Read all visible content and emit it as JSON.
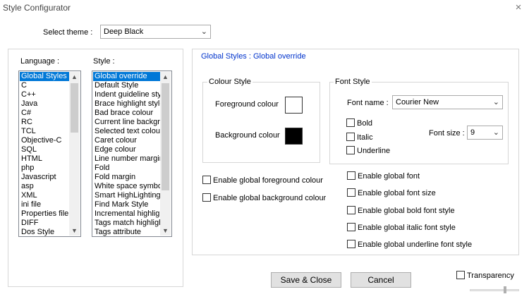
{
  "window": {
    "title": "Style Configurator",
    "close_glyph": "×"
  },
  "theme": {
    "label": "Select theme :",
    "selected": "Deep Black"
  },
  "language": {
    "label": "Language :",
    "items": [
      "Global Styles",
      "C",
      "C++",
      "Java",
      "C#",
      "RC",
      "TCL",
      "Objective-C",
      "SQL",
      "HTML",
      "php",
      "Javascript",
      "asp",
      "XML",
      "ini file",
      "Properties file",
      "DIFF",
      "Dos Style"
    ],
    "selected_index": 0
  },
  "style": {
    "label": "Style :",
    "items": [
      "Global override",
      "Default Style",
      "Indent guideline sty",
      "Brace highlight style",
      "Bad brace colour",
      "Current line backgro",
      "Selected text colour",
      "Caret colour",
      "Edge colour",
      "Line number margin",
      "Fold",
      "Fold margin",
      "White space symbol",
      "Smart HighLighting",
      "Find Mark Style",
      "Incremental highlight",
      "Tags match highlight",
      "Tags attribute"
    ],
    "selected_index": 0
  },
  "header": {
    "text": "Global Styles : Global override"
  },
  "colour_style": {
    "legend": "Colour Style",
    "foreground_label": "Foreground colour",
    "background_label": "Background colour",
    "foreground_color": "#ffffff",
    "background_color": "#000000"
  },
  "font_style": {
    "legend": "Font Style",
    "font_name_label": "Font name :",
    "font_name_value": "Courier New",
    "bold_label": "Bold",
    "italic_label": "Italic",
    "underline_label": "Underline",
    "font_size_label": "Font size :",
    "font_size_value": "9"
  },
  "global_options": {
    "enable_fg": "Enable global foreground colour",
    "enable_bg": "Enable global background colour",
    "enable_font": "Enable global font",
    "enable_font_size": "Enable global font size",
    "enable_bold": "Enable global bold font style",
    "enable_italic": "Enable global italic font style",
    "enable_underline": "Enable global underline font style"
  },
  "buttons": {
    "save_close": "Save & Close",
    "cancel": "Cancel"
  },
  "transparency": {
    "label": "Transparency"
  },
  "icons": {
    "dropdown": "chevron-down-icon",
    "scroll_up": "scroll-up-arrow-icon",
    "scroll_down": "scroll-down-arrow-icon",
    "close": "close-icon"
  },
  "colors": {
    "selection": "#0078d7",
    "header_text": "#0033cc"
  }
}
